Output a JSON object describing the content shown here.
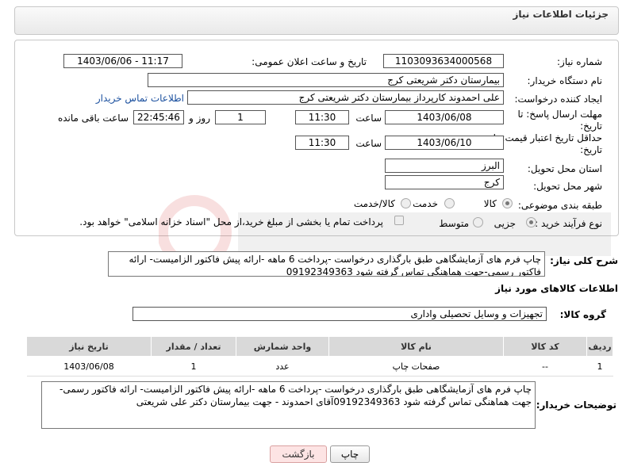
{
  "header": {
    "title": "جزئیات اطلاعات نیاز"
  },
  "form": {
    "need_number_label": "شماره نیاز:",
    "need_number": "1103093634000568",
    "announce_label": "تاریخ و ساعت اعلان عمومی:",
    "announce_value": "1403/06/06 - 11:17",
    "buyer_label": "نام دستگاه خریدار:",
    "buyer_value": "بیمارستان دکتر شریعتی کرج",
    "creator_label": "ایجاد کننده درخواست:",
    "creator_value": "علی احمدوند کارپرداز بیمارستان دکتر شریعتی کرج",
    "contact_link": "اطلاعات تماس خریدار",
    "deadline_label_1": "مهلت ارسال پاسخ: تا",
    "deadline_label_2": "تاریخ:",
    "deadline_date": "1403/06/08",
    "time_label": "ساعت",
    "deadline_time": "11:30",
    "days_value": "1",
    "days_label": "روز و",
    "remaining_time": "22:45:46",
    "remaining_label": "ساعت باقی مانده",
    "validity_label_1": "حداقل تاریخ اعتبار قیمت: تا",
    "validity_label_2": "تاریخ:",
    "validity_date": "1403/06/10",
    "validity_time": "11:30",
    "province_label": "استان محل تحویل:",
    "province_value": "البرز",
    "city_label": "شهر محل تحویل:",
    "city_value": "کرج",
    "category_label": "طبقه بندی موضوعی:",
    "category_options": [
      "کالا",
      "خدمت",
      "کالا/خدمت"
    ],
    "category_selected": "کالا",
    "process_label": "نوع فرآیند خرید :",
    "process_options": [
      "جزیی",
      "متوسط"
    ],
    "process_selected": "جزیی",
    "payment_note": "پرداخت تمام یا بخشی از مبلغ خرید،از محل \"اسناد خزانه اسلامی\" خواهد بود."
  },
  "summary": {
    "label": "شرح کلی نیاز:",
    "text": "چاپ فرم های آزمایشگاهی طبق بارگذاری درخواست -پرداخت 6 ماهه -ارائه پیش فاکتور الزامیست- ارائه فاکتور رسمی-جهت هماهنگی تماس گرفته شود 09192349363"
  },
  "goods": {
    "section_title": "اطلاعات کالاهای مورد نیاز",
    "group_label": "گروه کالا:",
    "group_value": "تجهیزات و وسایل تحصیلی واداری",
    "columns": [
      "ردیف",
      "کد کالا",
      "نام کالا",
      "واحد شمارش",
      "تعداد / مقدار",
      "تاریخ نیاز"
    ],
    "rows": [
      {
        "row": "1",
        "code": "--",
        "name": "صفحات چاپ",
        "unit": "عدد",
        "qty": "1",
        "date": "1403/06/08"
      }
    ]
  },
  "buyer_notes": {
    "label": "توضیحات خریدار:",
    "text": "چاپ فرم های آزمایشگاهی طبق بارگذاری درخواست -پرداخت 6 ماهه -ارائه پیش فاکتور الزامیست- ارائه فاکتور رسمی-جهت هماهنگی تماس گرفته شود 09192349363آقای احمدوند - جهت بیمارستان دکتر علی شریعتی"
  },
  "buttons": {
    "print": "چاپ",
    "back": "بازگشت"
  },
  "colors": {
    "link": "#1a4f9e",
    "table_header": "#d9d9d9",
    "back_button": "#fde4e4"
  }
}
